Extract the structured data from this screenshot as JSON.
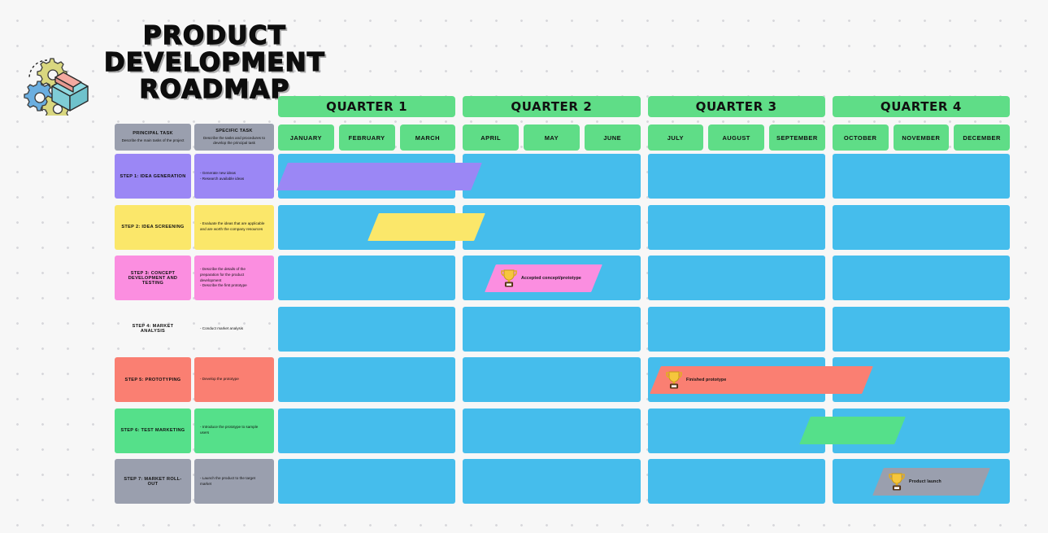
{
  "title": {
    "line1": "PRODUCT",
    "line2": "DEVELOPMENT",
    "line3": "ROADMAP",
    "logo_icon": "gears-and-box-icon"
  },
  "colors": {
    "canvas": "#f7f7f7",
    "quarter_header": "#5fdd87",
    "track": "#45bdec",
    "column_header": "#9a9fae"
  },
  "table_headers": {
    "principal": {
      "title": "PRINCIPAL TASK",
      "subtitle": "Describe the main tasks of the project"
    },
    "specific": {
      "title": "SPECIFIC TASK",
      "subtitle": "Describe the tasks and procedures to develop the principal task"
    }
  },
  "quarters": [
    {
      "label": "QUARTER 1",
      "months": [
        "JANUARY",
        "FEBRUARY",
        "MARCH"
      ]
    },
    {
      "label": "QUARTER 2",
      "months": [
        "APRIL",
        "MAY",
        "JUNE"
      ]
    },
    {
      "label": "QUARTER 3",
      "months": [
        "JULY",
        "AUGUST",
        "SEPTEMBER"
      ]
    },
    {
      "label": "QUARTER 4",
      "months": [
        "OCTOBER",
        "NOVEMBER",
        "DECEMBER"
      ]
    }
  ],
  "rows": [
    {
      "task": "STEP 1: IDEA GENERATION",
      "color": "#9b87f5",
      "specific_lines": [
        "- Generate new ideas",
        "- Research available ideas"
      ],
      "bar": {
        "color": "#9b87f5",
        "start_pct": 0.5,
        "width_pct": 26.5,
        "milestone": null
      }
    },
    {
      "task": "STEP 2: IDEA SCREENING",
      "color": "#fbe76a",
      "specific_lines": [
        "- Evaluate the ideas that are applicable",
        "and are worth the company resources"
      ],
      "bar": {
        "color": "#fbe76a",
        "start_pct": 13.0,
        "width_pct": 14.5,
        "milestone": null
      }
    },
    {
      "task": "STEP 3: CONCEPT DEVELOPMENT AND TESTING",
      "color": "#fb8ee0",
      "specific_lines": [
        "- Describe the details of the",
        "preparation for the product",
        "development",
        "- Describe the first prototype"
      ],
      "bar": {
        "color": "#fb8ee0",
        "start_pct": 29.0,
        "width_pct": 14.5,
        "milestone": "Accepted concept/prototype"
      }
    },
    {
      "task": "STEP 4: MARKET ANALYSIS",
      "color": "#f8a council",
      "specific_lines": [
        "- Conduct market analysis"
      ],
      "bar": {
        "color": "#f8a council",
        "start_pct": 37.5,
        "width_pct": 17.0,
        "milestone": null
      }
    },
    {
      "task": "STEP 5: PROTOTYPING",
      "color": "#fa7f72",
      "specific_lines": [
        "- Develop the prototype"
      ],
      "bar": {
        "color": "#fa7f72",
        "start_pct": 51.5,
        "width_pct": 29.0,
        "milestone": "Finished prototype"
      }
    },
    {
      "task": "STEP 6: TEST MARKETING",
      "color": "#55e08a",
      "specific_lines": [
        "- Introduce the prototype to sample",
        "users"
      ],
      "bar": {
        "color": "#55e08a",
        "start_pct": 72.0,
        "width_pct": 13.0,
        "milestone": null
      }
    },
    {
      "task": "STEP 7: MARKET ROLL-OUT",
      "color": "#9a9fae",
      "specific_lines": [
        "- Launch the product to the target",
        "market"
      ],
      "bar": {
        "color": "#9a9fae",
        "start_pct": 82.0,
        "width_pct": 14.5,
        "milestone": "Product launch"
      }
    }
  ],
  "icons": {
    "milestone": "trophy-icon"
  }
}
